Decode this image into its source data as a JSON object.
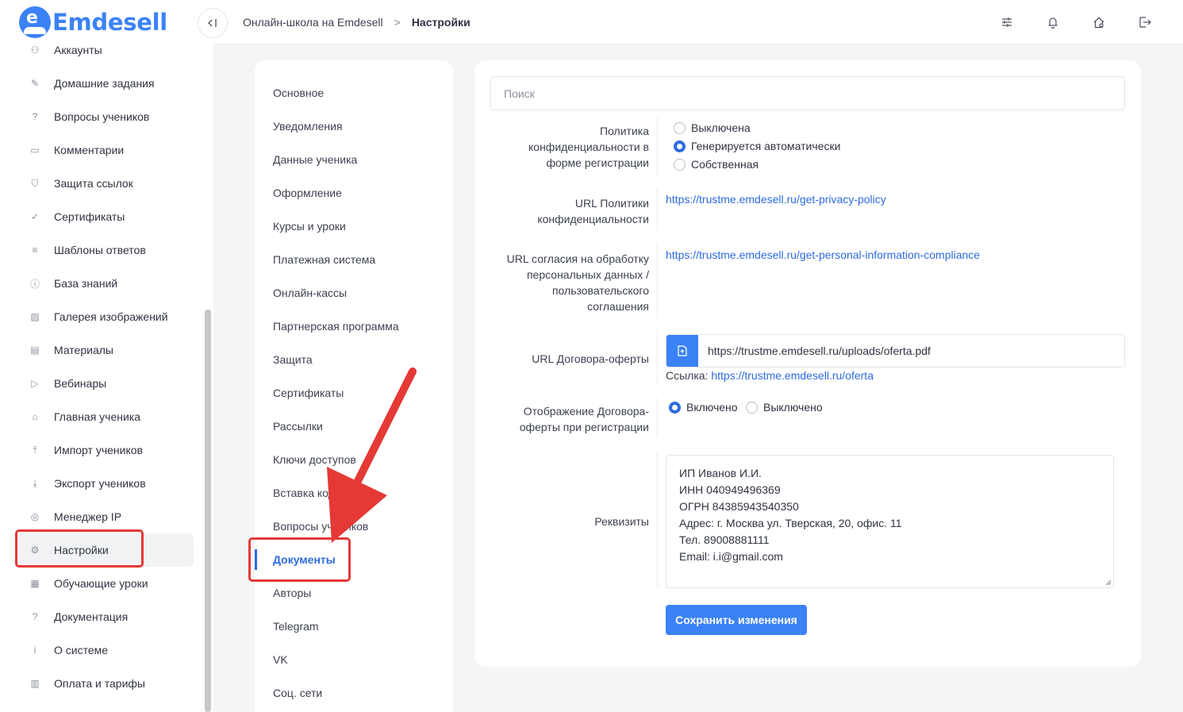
{
  "app": {
    "logo_letter": "e",
    "logo_text": "Emdesell"
  },
  "sidebar": {
    "items": [
      {
        "label": "Аккаунты",
        "icon": "users-icon",
        "glyph": "⚇"
      },
      {
        "label": "Домашние задания",
        "icon": "pencil-icon",
        "glyph": "✎"
      },
      {
        "label": "Вопросы учеников",
        "icon": "question-circle-icon",
        "glyph": "?"
      },
      {
        "label": "Комментарии",
        "icon": "comment-icon",
        "glyph": "▭"
      },
      {
        "label": "Защита ссылок",
        "icon": "shield-icon",
        "glyph": "⛉"
      },
      {
        "label": "Сертификаты",
        "icon": "check-circle-icon",
        "glyph": "✓"
      },
      {
        "label": "Шаблоны ответов",
        "icon": "list-icon",
        "glyph": "≡"
      },
      {
        "label": "База знаний",
        "icon": "info-circle-icon",
        "glyph": "ⓘ"
      },
      {
        "label": "Галерея изображений",
        "icon": "image-icon",
        "glyph": "▨"
      },
      {
        "label": "Материалы",
        "icon": "briefcase-icon",
        "glyph": "▤"
      },
      {
        "label": "Вебинары",
        "icon": "play-icon",
        "glyph": "▷"
      },
      {
        "label": "Главная ученика",
        "icon": "home-icon",
        "glyph": "⌂"
      },
      {
        "label": "Импорт учеников",
        "icon": "upload-icon",
        "glyph": "⤒"
      },
      {
        "label": "Экспорт учеников",
        "icon": "download-icon",
        "glyph": "⤓"
      },
      {
        "label": "Менеджер IP",
        "icon": "target-icon",
        "glyph": "◎"
      },
      {
        "label": "Настройки",
        "icon": "gear-icon",
        "glyph": "⚙"
      },
      {
        "label": "Обучающие уроки",
        "icon": "film-icon",
        "glyph": "▦"
      },
      {
        "label": "Документация",
        "icon": "help-box-icon",
        "glyph": "?"
      },
      {
        "label": "О системе",
        "icon": "info-box-icon",
        "glyph": "i"
      },
      {
        "label": "Оплата и тарифы",
        "icon": "invoice-icon",
        "glyph": "▥"
      }
    ],
    "active_index": 15
  },
  "topbar": {
    "breadcrumb": {
      "parent": "Онлайн-школа на Emdesell",
      "separator": ">",
      "current": "Настройки"
    },
    "icons": [
      "sliders-icon",
      "bell-icon",
      "home-settings-icon",
      "logout-icon"
    ]
  },
  "submenu": {
    "items": [
      "Основное",
      "Уведомления",
      "Данные ученика",
      "Оформление",
      "Курсы и уроки",
      "Платежная система",
      "Онлайн-кассы",
      "Партнерская программа",
      "Защита",
      "Сертификаты",
      "Рассылки",
      "Ключи доступов",
      "Вставка кода",
      "Вопросы учеников",
      "Документы",
      "Авторы",
      "Telegram",
      "VK",
      "Соц. сети"
    ],
    "active_index": 14
  },
  "form": {
    "search_placeholder": "Поиск",
    "privacy": {
      "label": "Политика конфиденциальности в форме регистрации",
      "options": [
        "Выключена",
        "Генерируется автоматически",
        "Собственная"
      ],
      "selected": 1
    },
    "privacy_url": {
      "label": "URL Политики конфиденциальности",
      "value": "https://trustme.emdesell.ru/get-privacy-policy"
    },
    "consent_url": {
      "label": "URL согласия на обработку персональных данных / пользовательского соглашения",
      "value": "https://trustme.emdesell.ru/get-personal-information-compliance"
    },
    "offer_url": {
      "label": "URL Договора-оферты",
      "value": "https://trustme.emdesell.ru/uploads/oferta.pdf",
      "hint_prefix": "Ссылка:",
      "hint_link": "https://trustme.emdesell.ru/oferta"
    },
    "offer_display": {
      "label": "Отображение Договора-оферты при регистрации",
      "options": [
        "Включено",
        "Выключено"
      ],
      "selected": 0
    },
    "requisites": {
      "label": "Реквизиты",
      "lines": [
        "ИП Иванов И.И.",
        "ИНН 040949496369",
        "ОГРН 84385943540350",
        "Адрес: г. Москва ул. Тверская, 20, офис. 11",
        "Тел. 89008881111",
        "Email: i.i@gmail.com"
      ]
    },
    "save_label": "Сохранить изменения"
  },
  "colors": {
    "accent": "#3b82f6",
    "link": "#2d6be0",
    "annotation": "#e53935"
  }
}
